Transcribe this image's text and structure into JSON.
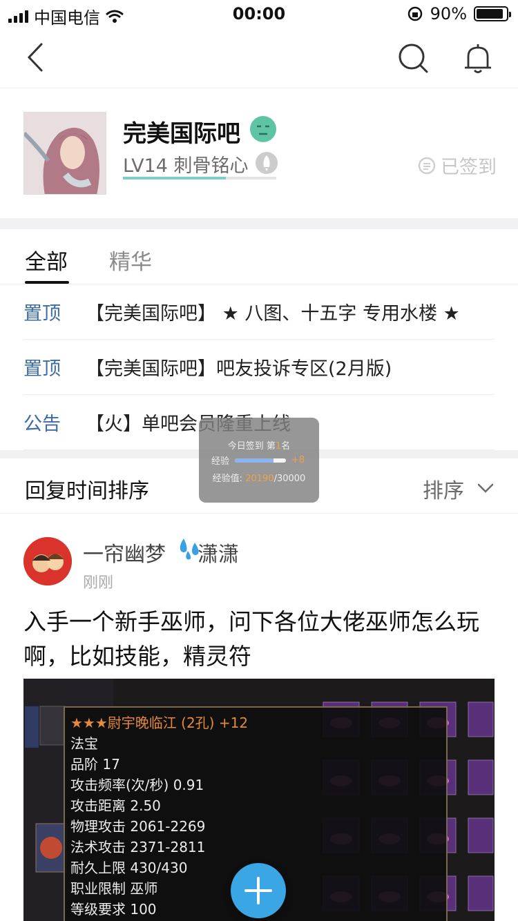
{
  "status_bar": {
    "carrier": "中国电信",
    "time": "00:00",
    "battery_percent": "90%",
    "battery_level": 0.9
  },
  "nav": {
    "icons": [
      "back-arrow-icon",
      "search-icon",
      "bell-icon"
    ]
  },
  "forum": {
    "name": "完美国际吧",
    "level_text": "LV14 刺骨铭心",
    "level_progress": 0.67,
    "signed_label": "已签到"
  },
  "tabs": [
    {
      "label": "全部",
      "active": true
    },
    {
      "label": "精华",
      "active": false
    }
  ],
  "pinned": [
    {
      "tag": "置顶",
      "text": "【完美国际吧】 ★ 八图、十五字 专用水楼 ★"
    },
    {
      "tag": "置顶",
      "text": "【完美国际吧】吧友投诉专区(2月版)"
    },
    {
      "tag": "公告",
      "text": "【火】单吧会员隆重上线"
    }
  ],
  "sort": {
    "label": "回复时间排序",
    "button": "排序"
  },
  "post": {
    "author_a": "一帘幽梦",
    "author_b": "潇潇",
    "time": "刚刚",
    "body": "入手一个新手巫师，问下各位大佬巫师怎么玩啊，比如技能，精灵符",
    "image_tooltip": [
      "★★★尉宇晚临江 (2孔) +12",
      "法宝",
      "品阶 17",
      "攻击频率(次/秒) 0.91",
      "攻击距离 2.50",
      "物理攻击 2061-2269",
      "法术攻击 2371-2811",
      "耐久上限 430/430",
      "职业限制 巫师",
      "等级要求 100"
    ]
  },
  "toast": {
    "line1_prefix": "今日签到 第",
    "rank": "1",
    "line1_suffix": "名",
    "exp_label": "经验",
    "exp_gain": "+8",
    "exp_fill": 0.75,
    "value_label": "经验值:",
    "value_current": "20190",
    "value_total": "/30000"
  },
  "colors": {
    "link_blue": "#3d6ba5",
    "level_bar": "#7dcfc6",
    "fab_blue": "#3aa6e4"
  }
}
